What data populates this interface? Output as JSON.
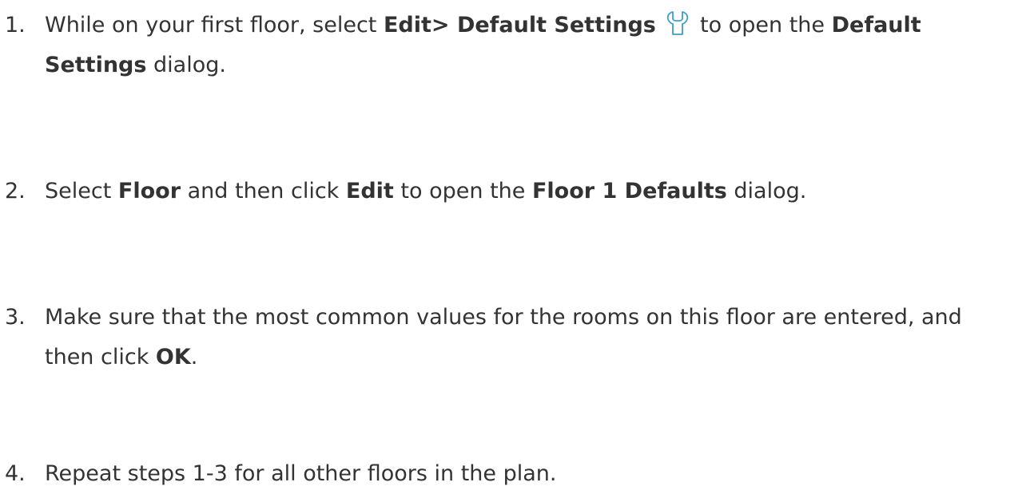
{
  "steps": [
    {
      "number": "1.",
      "parts": {
        "a": "While on your first floor, select ",
        "b": "Edit> Default Settings",
        "c": " to open the ",
        "d": "Default Settings",
        "e": " dialog."
      },
      "icon": "wrench-icon",
      "icon_color": "#3a9fc9"
    },
    {
      "number": "2.",
      "parts": {
        "a": "Select ",
        "b": "Floor",
        "c": " and then click ",
        "d": "Edit",
        "e": " to open the ",
        "f": "Floor 1 Defaults",
        "g": " dialog."
      }
    },
    {
      "number": "3.",
      "parts": {
        "a": "Make sure that the most common values for the rooms on this floor are entered, and then click ",
        "b": "OK",
        "c": "."
      }
    },
    {
      "number": "4.",
      "parts": {
        "a": "Repeat steps 1-3 for all other floors in the plan."
      }
    }
  ],
  "colors": {
    "text": "#333333",
    "background": "#ffffff"
  }
}
